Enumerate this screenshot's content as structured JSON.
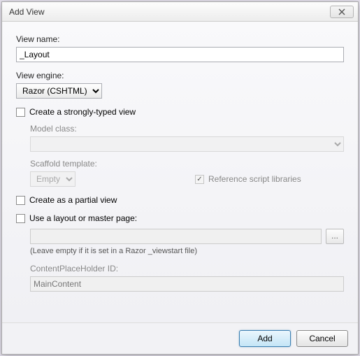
{
  "dialog": {
    "title": "Add View"
  },
  "viewName": {
    "label": "View name:",
    "value": "_Layout"
  },
  "viewEngine": {
    "label": "View engine:",
    "selected": "Razor (CSHTML)"
  },
  "stronglyTyped": {
    "label": "Create a strongly-typed view",
    "checked": false
  },
  "modelClass": {
    "label": "Model class:",
    "value": ""
  },
  "scaffold": {
    "label": "Scaffold template:",
    "selected": "Empty"
  },
  "refScripts": {
    "label": "Reference script libraries",
    "checked": true
  },
  "partial": {
    "label": "Create as a partial view",
    "checked": false
  },
  "useLayout": {
    "label": "Use a layout or master page:",
    "checked": false,
    "path": "",
    "hint": "(Leave empty if it is set in a Razor _viewstart file)"
  },
  "placeholder": {
    "label": "ContentPlaceHolder ID:",
    "value": "MainContent"
  },
  "buttons": {
    "add": "Add",
    "cancel": "Cancel",
    "browse": "..."
  }
}
